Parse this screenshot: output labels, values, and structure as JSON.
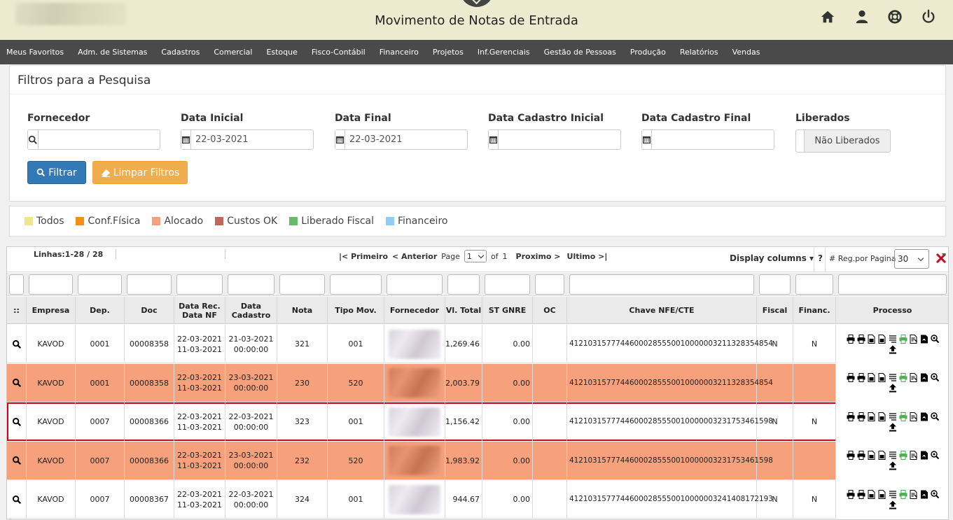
{
  "header": {
    "title": "Movimento de Notas de Entrada",
    "icons": [
      "home-icon",
      "user-icon",
      "help-icon",
      "power-icon"
    ]
  },
  "menu": {
    "items": [
      "Meus Favoritos",
      "Adm. de Sistemas",
      "Cadastros",
      "Comercial",
      "Estoque",
      "Fisco-Contábil",
      "Financeiro",
      "Projetos",
      "Inf.Gerenciais",
      "Gestão de Pessoas",
      "Produção",
      "Relatórios",
      "Vendas"
    ]
  },
  "filters": {
    "title": "Filtros para a Pesquisa",
    "fornecedor_label": "Fornecedor",
    "fornecedor_value": "",
    "data_inicial_label": "Data Inicial",
    "data_inicial_value": "22-03-2021",
    "data_final_label": "Data Final",
    "data_final_value": "22-03-2021",
    "data_cad_inicial_label": "Data Cadastro Inicial",
    "data_cad_inicial_value": "",
    "data_cad_final_label": "Data Cadastro Final",
    "data_cad_final_value": "",
    "liberados_label": "Liberados",
    "liberados_value": "Não Liberados",
    "filtrar_label": "Filtrar",
    "limpar_label": "Limpar Filtros"
  },
  "legend": [
    {
      "label": "Todos",
      "color": "#f0e68c"
    },
    {
      "label": "Conf.Física",
      "color": "#f39012"
    },
    {
      "label": "Alocado",
      "color": "#f6a07c"
    },
    {
      "label": "Custos OK",
      "color": "#c1685a"
    },
    {
      "label": "Liberado Fiscal",
      "color": "#66bb6a"
    },
    {
      "label": "Financeiro",
      "color": "#8ecdf4"
    }
  ],
  "toolbar": {
    "linhas": "Linhas:1-28 / 28",
    "primeiro": "|< Primeiro",
    "anterior": "< Anterior",
    "page_label": "Page",
    "page_value": "1",
    "of_label": "of",
    "total_pages": "1",
    "proximo": "Proximo >",
    "ultimo": "Ultimo >|",
    "display_columns": "Display columns",
    "help": "?",
    "reg_label": "# Reg.por Pagina",
    "reg_value": "30"
  },
  "columns": [
    "::",
    "Empresa",
    "Dep.",
    "Doc",
    "Data Rec.\nData NF",
    "Data\nCadastro",
    "Nota",
    "Tipo Mov.",
    "Fornecedor",
    "Vl. Total",
    "ST GNRE",
    "OC",
    "Chave NFE/CTE",
    "Fiscal",
    "Financ.",
    "Processo"
  ],
  "rows": [
    {
      "color": "white",
      "selected": false,
      "empresa": "KAVOD",
      "dep": "0001",
      "doc": "00008358",
      "data_rec": "22-03-2021",
      "data_nf": "11-03-2021",
      "data_cad": "21-03-2021",
      "hora_cad": "00:00:00",
      "nota": "321",
      "tipo": "001",
      "total": "1,269.46",
      "st": "0.00",
      "oc": "",
      "chave": "41210315777446000285550010000003211328354854",
      "fiscal": "N",
      "financ": "N"
    },
    {
      "color": "orange",
      "selected": false,
      "empresa": "KAVOD",
      "dep": "0001",
      "doc": "00008358",
      "data_rec": "22-03-2021",
      "data_nf": "11-03-2021",
      "data_cad": "23-03-2021",
      "hora_cad": "00:00:00",
      "nota": "230",
      "tipo": "520",
      "total": "2,003.79",
      "st": "0.00",
      "oc": "",
      "chave": "41210315777446000285550010000003211328354854",
      "fiscal": "",
      "financ": ""
    },
    {
      "color": "white",
      "selected": true,
      "empresa": "KAVOD",
      "dep": "0007",
      "doc": "00008366",
      "data_rec": "22-03-2021",
      "data_nf": "11-03-2021",
      "data_cad": "22-03-2021",
      "hora_cad": "00:00:00",
      "nota": "323",
      "tipo": "001",
      "total": "1,156.42",
      "st": "0.00",
      "oc": "",
      "chave": "41210315777446000285550010000003231753461598",
      "fiscal": "N",
      "financ": "N"
    },
    {
      "color": "orange",
      "selected": false,
      "empresa": "KAVOD",
      "dep": "0007",
      "doc": "00008366",
      "data_rec": "22-03-2021",
      "data_nf": "11-03-2021",
      "data_cad": "23-03-2021",
      "hora_cad": "00:00:00",
      "nota": "232",
      "tipo": "520",
      "total": "1,983.92",
      "st": "0.00",
      "oc": "",
      "chave": "41210315777446000285550010000003231753461598",
      "fiscal": "",
      "financ": ""
    },
    {
      "color": "white",
      "selected": false,
      "empresa": "KAVOD",
      "dep": "0007",
      "doc": "00008367",
      "data_rec": "22-03-2021",
      "data_nf": "11-03-2021",
      "data_cad": "22-03-2021",
      "hora_cad": "00:00:00",
      "nota": "324",
      "tipo": "001",
      "total": "944.67",
      "st": "0.00",
      "oc": "",
      "chave": "41210315777446000285550010000003241408172193",
      "fiscal": "N",
      "financ": "N"
    }
  ],
  "process_icons": [
    "printer-icon",
    "printer-icon",
    "document-icon",
    "document-icon",
    "list-icon",
    "printer-green-icon",
    "document-edit-icon",
    "pdf-icon",
    "zoom-icon",
    "upload-icon"
  ]
}
